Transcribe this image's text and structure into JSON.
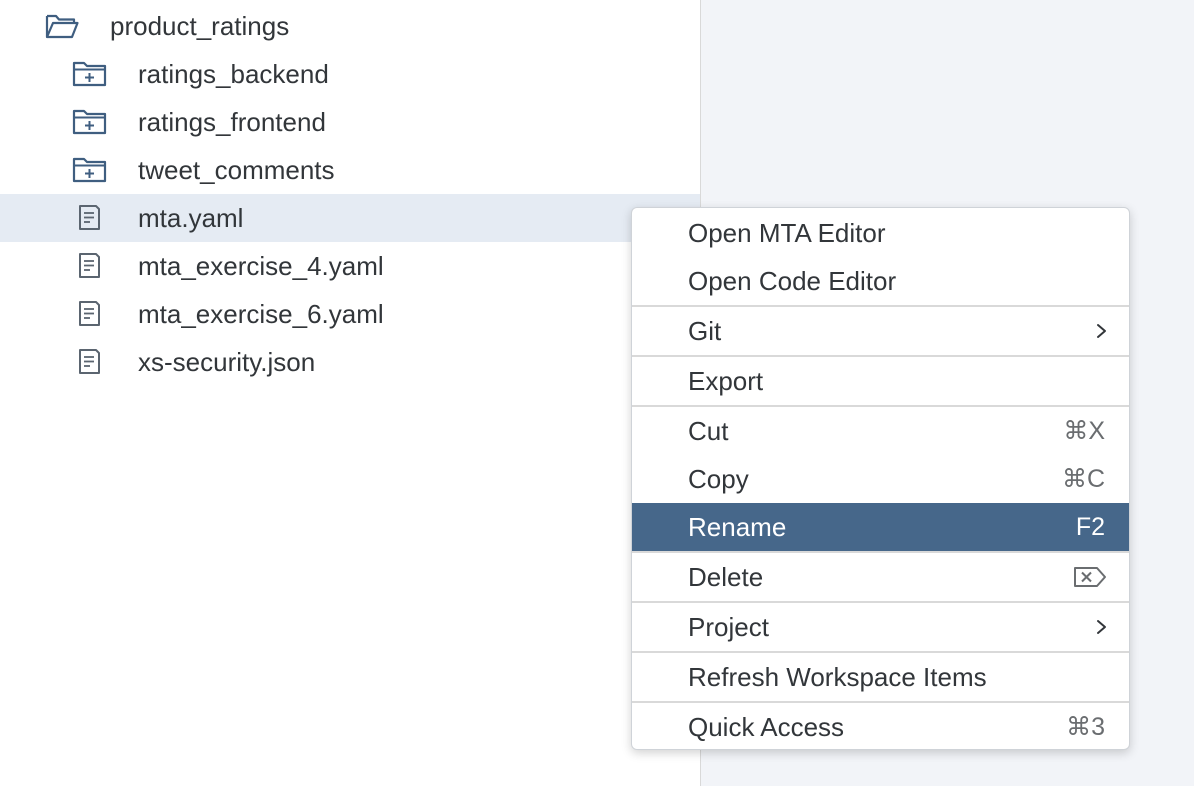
{
  "tree": {
    "items": [
      {
        "label": "product_ratings",
        "icon": "folder-open-icon"
      },
      {
        "label": "ratings_backend",
        "icon": "module-folder-icon"
      },
      {
        "label": "ratings_frontend",
        "icon": "module-folder-icon"
      },
      {
        "label": "tweet_comments",
        "icon": "module-folder-icon"
      },
      {
        "label": "mta.yaml",
        "icon": "file-icon",
        "selected": true
      },
      {
        "label": "mta_exercise_4.yaml",
        "icon": "file-icon"
      },
      {
        "label": "mta_exercise_6.yaml",
        "icon": "file-icon"
      },
      {
        "label": "xs-security.json",
        "icon": "file-icon"
      }
    ]
  },
  "context_menu": {
    "items": [
      {
        "label": "Open MTA Editor"
      },
      {
        "label": "Open Code Editor"
      },
      {
        "label": "Git",
        "submenu": true
      },
      {
        "label": "Export"
      },
      {
        "label": "Cut",
        "shortcut": "⌘X"
      },
      {
        "label": "Copy",
        "shortcut": "⌘C"
      },
      {
        "label": "Rename",
        "shortcut": "F2",
        "active": true
      },
      {
        "label": "Delete",
        "shortcut_icon": "delete-key-icon"
      },
      {
        "label": "Project",
        "submenu": true
      },
      {
        "label": "Refresh Workspace Items"
      },
      {
        "label": "Quick Access",
        "shortcut": "⌘3"
      }
    ]
  },
  "colors": {
    "accent_highlight": "#46678a",
    "selection_background": "#e5ebf3",
    "icon_color": "#3f5e80",
    "text": "#32363a",
    "right_pane_background": "#f2f4f8"
  }
}
